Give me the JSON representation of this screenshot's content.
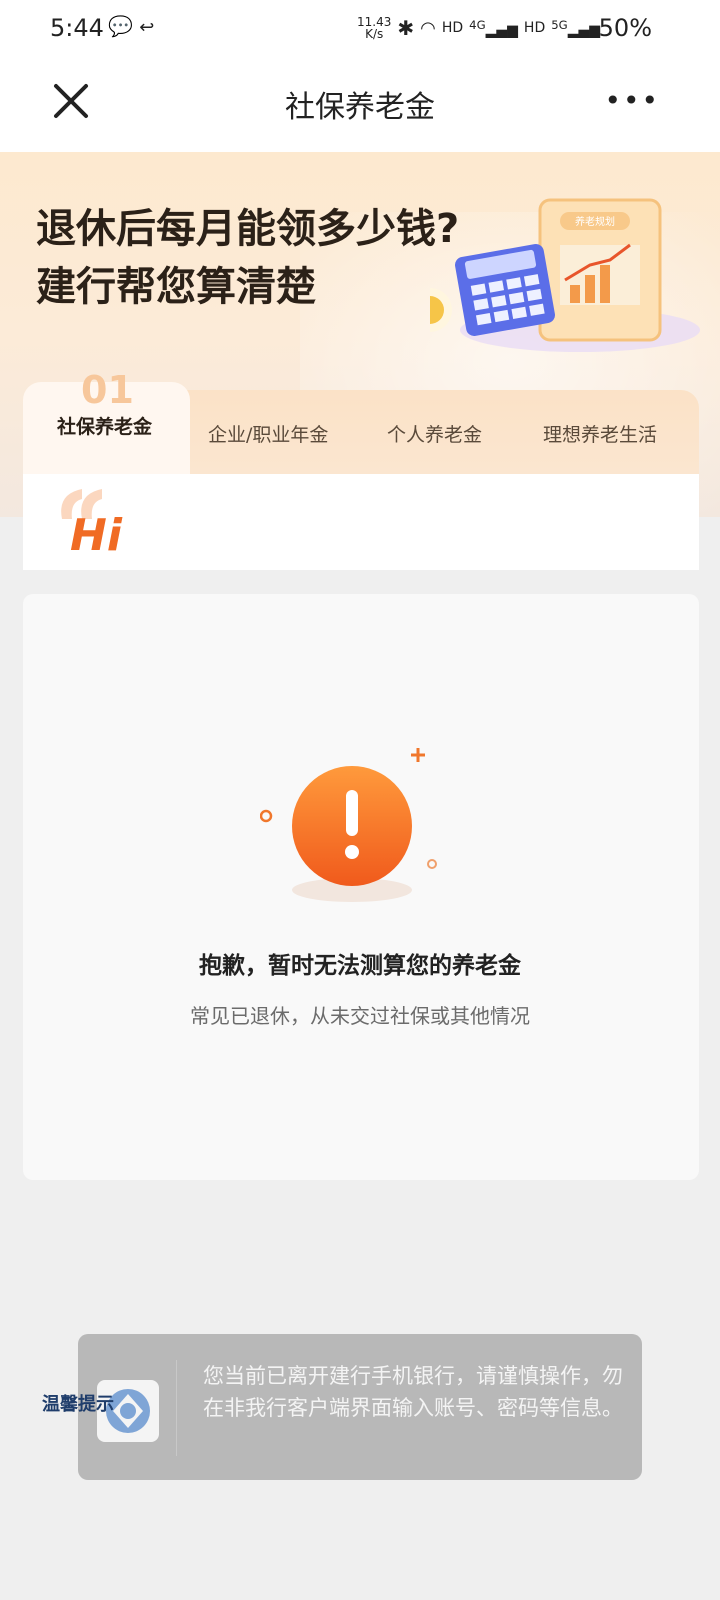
{
  "status_bar": {
    "time": "5:44",
    "net_speed_value": "11.43",
    "net_speed_unit": "K/s",
    "hd1": "HD",
    "net1": "4G",
    "hd2": "HD",
    "net2": "5G",
    "battery": "50%"
  },
  "nav": {
    "title": "社保养老金",
    "more": "•••"
  },
  "banner": {
    "line1": "退休后每月能领多少钱?",
    "line2": "建行帮您算清楚",
    "illus_tag": "养老规划"
  },
  "tabs": {
    "active_number": "01",
    "items": [
      {
        "label": "社保养老金"
      },
      {
        "label": "企业/职业年金"
      },
      {
        "label": "个人养老金"
      },
      {
        "label": "理想养老生活"
      }
    ]
  },
  "greeting": "Hi",
  "error": {
    "title": "抱歉，暂时无法测算您的养老金",
    "subtitle": "常见已退休，从未交过社保或其他情况"
  },
  "toast": {
    "label": "温馨提示",
    "message": "您当前已离开建行手机银行，请谨慎操作，勿在非我行客户端界面输入账号、密码等信息。"
  },
  "colors": {
    "accent": "#f06b24",
    "banner_bg": "#fde9cf",
    "toast_bg": "#b8b8b8"
  }
}
